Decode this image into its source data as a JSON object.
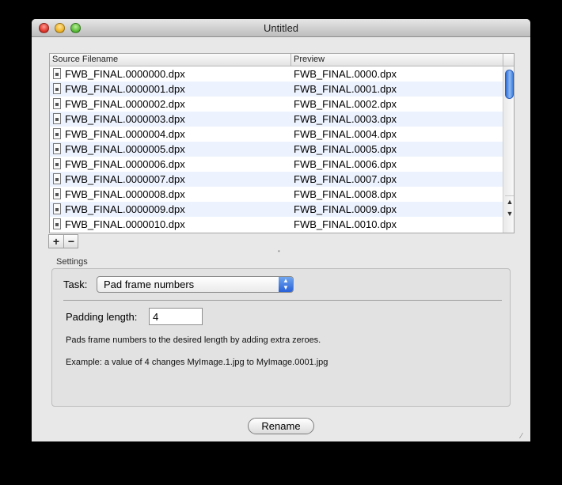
{
  "window": {
    "title": "Untitled"
  },
  "table": {
    "headers": {
      "source": "Source Filename",
      "preview": "Preview"
    },
    "rows": [
      {
        "source": "FWB_FINAL.0000000.dpx",
        "preview": "FWB_FINAL.0000.dpx"
      },
      {
        "source": "FWB_FINAL.0000001.dpx",
        "preview": "FWB_FINAL.0001.dpx"
      },
      {
        "source": "FWB_FINAL.0000002.dpx",
        "preview": "FWB_FINAL.0002.dpx"
      },
      {
        "source": "FWB_FINAL.0000003.dpx",
        "preview": "FWB_FINAL.0003.dpx"
      },
      {
        "source": "FWB_FINAL.0000004.dpx",
        "preview": "FWB_FINAL.0004.dpx"
      },
      {
        "source": "FWB_FINAL.0000005.dpx",
        "preview": "FWB_FINAL.0005.dpx"
      },
      {
        "source": "FWB_FINAL.0000006.dpx",
        "preview": "FWB_FINAL.0006.dpx"
      },
      {
        "source": "FWB_FINAL.0000007.dpx",
        "preview": "FWB_FINAL.0007.dpx"
      },
      {
        "source": "FWB_FINAL.0000008.dpx",
        "preview": "FWB_FINAL.0008.dpx"
      },
      {
        "source": "FWB_FINAL.0000009.dpx",
        "preview": "FWB_FINAL.0009.dpx"
      },
      {
        "source": "FWB_FINAL.0000010.dpx",
        "preview": "FWB_FINAL.0010.dpx"
      }
    ]
  },
  "list_controls": {
    "add": "+",
    "remove": "−"
  },
  "settings": {
    "group_label": "Settings",
    "task_label": "Task:",
    "task_value": "Pad frame numbers",
    "padding_label": "Padding length:",
    "padding_value": "4",
    "description": "Pads frame numbers to the desired length by adding extra zeroes.",
    "example": "Example: a value of 4 changes MyImage.1.jpg to MyImage.0001.jpg"
  },
  "rename_button": "Rename",
  "icons": {
    "close": "close-icon",
    "minimize": "minimize-icon",
    "zoom": "zoom-icon",
    "file": "file-icon"
  },
  "colors": {
    "alt_row": "#edf3fe",
    "scroll_thumb": "#2b69d6",
    "close": "#e0392e",
    "minimize": "#f0b72c",
    "zoom": "#5cbd3a"
  }
}
